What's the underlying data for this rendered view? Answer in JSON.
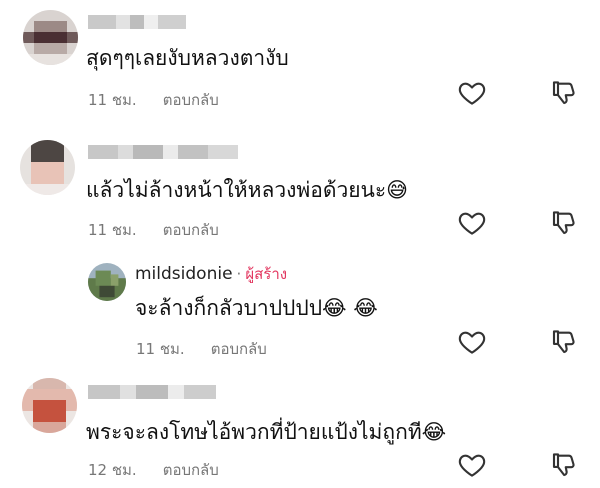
{
  "comments": [
    {
      "text": "สุดๆๆเลยงับหลวงตางับ",
      "time": "11 ชม.",
      "reply_label": "ตอบกลับ"
    },
    {
      "text": "แล้วไม่ล้างหน้าให้หลวงพ่อด้วยนะ😅",
      "time": "11 ชม.",
      "reply_label": "ตอบกลับ",
      "replies": [
        {
          "username": "mildsidonie",
          "separator": "·",
          "badge": "ผู้สร้าง",
          "text": "จะล้างก็กลัวบาปปปป😂 😂",
          "time": "11 ชม.",
          "reply_label": "ตอบกลับ"
        }
      ]
    },
    {
      "text": "พระจะลงโทษไอ้พวกที่ป้ายแป้งไม่ถูกที😂",
      "time": "12 ชม.",
      "reply_label": "ตอบกลับ"
    }
  ],
  "icons": {
    "like": "heart-icon",
    "dislike": "thumbs-down-icon"
  },
  "colors": {
    "creator_badge": "#e2365f",
    "meta_text": "#777777"
  }
}
